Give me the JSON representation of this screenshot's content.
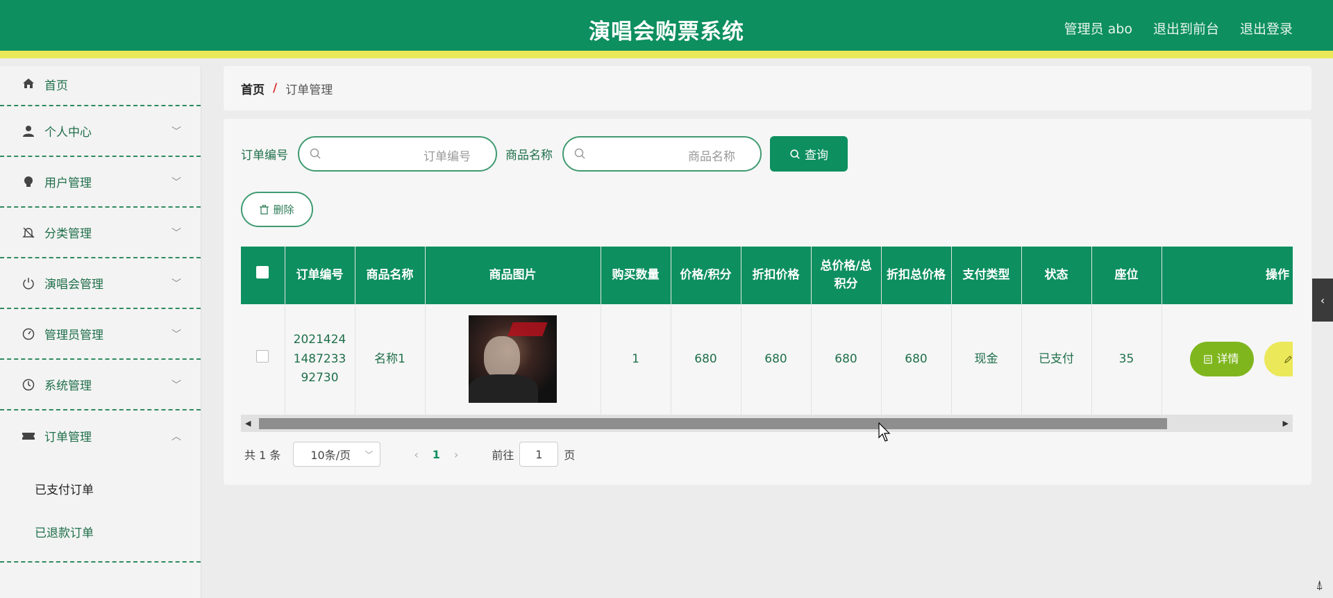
{
  "header": {
    "title": "演唱会购票系统",
    "user_label": "管理员 abo",
    "front_link": "退出到前台",
    "logout_link": "退出登录"
  },
  "sidebar": {
    "items": [
      {
        "label": "首页",
        "icon": "home-icon"
      },
      {
        "label": "个人中心",
        "icon": "person-icon"
      },
      {
        "label": "用户管理",
        "icon": "lightbulb-icon"
      },
      {
        "label": "分类管理",
        "icon": "bell-off-icon"
      },
      {
        "label": "演唱会管理",
        "icon": "power-icon"
      },
      {
        "label": "管理员管理",
        "icon": "gauge-icon"
      },
      {
        "label": "系统管理",
        "icon": "clock-icon"
      },
      {
        "label": "订单管理",
        "icon": "ticket-icon"
      }
    ],
    "sub_items": [
      {
        "label": "已支付订单"
      },
      {
        "label": "已退款订单"
      }
    ]
  },
  "breadcrumb": {
    "home": "首页",
    "separator": "/",
    "current": "订单管理"
  },
  "search": {
    "order_no_label": "订单编号",
    "order_no_placeholder": "订单编号",
    "product_label": "商品名称",
    "product_placeholder": "商品名称",
    "query_button": "查询"
  },
  "actions": {
    "delete_button": "删除"
  },
  "table": {
    "columns": [
      "订单编号",
      "商品名称",
      "商品图片",
      "购买数量",
      "价格/积分",
      "折扣价格",
      "总价格/总积分",
      "折扣总价格",
      "支付类型",
      "状态",
      "座位",
      "操作"
    ],
    "rows": [
      {
        "order_no": "202142414872339273​0",
        "order_no_lines": [
          "2021424",
          "1487233",
          "92730"
        ],
        "product_name": "名称1",
        "quantity": "1",
        "price": "680",
        "discount_price": "680",
        "total_price": "680",
        "discount_total": "680",
        "pay_type": "现金",
        "status": "已支付",
        "seat": "35",
        "detail_button": "详情",
        "edit_button": "修"
      }
    ]
  },
  "pagination": {
    "total": "共 1 条",
    "page_size": "10条/页",
    "current_page": "1",
    "goto_label": "前往",
    "goto_value": "1",
    "page_suffix": "页"
  },
  "colors": {
    "primary": "#0d8f5f",
    "accent_yellow": "#ebe85a",
    "detail_green": "#7fb61e"
  }
}
